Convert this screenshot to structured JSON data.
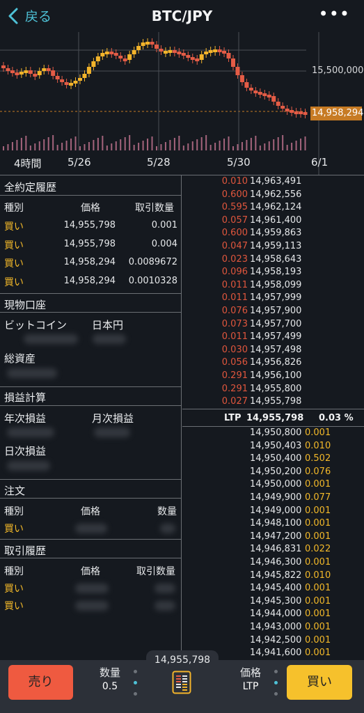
{
  "header": {
    "back_label": "戻る",
    "title": "BTC/JPY",
    "more": "•••"
  },
  "chart": {
    "price_label": "15,500,000",
    "last_price": "14,958,294",
    "x_labels": [
      "4時間",
      "5/26",
      "5/28",
      "5/30",
      "6/1"
    ],
    "colors": {
      "up": "#f3b42b",
      "down": "#e45c46",
      "volume": "#d47e9c",
      "grid": "#4a4e55",
      "last": "#c77b24"
    }
  },
  "executions": {
    "title": "全約定履歴",
    "headers": [
      "種別",
      "価格",
      "取引数量"
    ],
    "rows": [
      {
        "side": "買い",
        "price": "14,955,798",
        "qty": "0.001"
      },
      {
        "side": "買い",
        "price": "14,955,798",
        "qty": "0.004"
      },
      {
        "side": "買い",
        "price": "14,958,294",
        "qty": "0.0089672"
      },
      {
        "side": "買い",
        "price": "14,958,294",
        "qty": "0.0010328"
      }
    ]
  },
  "spot_account": {
    "title": "現物口座",
    "bitcoin": "ビットコイン",
    "jpy": "日本円",
    "total": "総資産"
  },
  "pnl": {
    "title": "損益計算",
    "yearly": "年次損益",
    "monthly": "月次損益",
    "daily": "日次損益"
  },
  "orders": {
    "title": "注文",
    "headers": [
      "種別",
      "価格",
      "数量"
    ],
    "rows": [
      {
        "side": "買い"
      }
    ]
  },
  "history": {
    "title": "取引履歴",
    "headers": [
      "種別",
      "価格",
      "取引数量"
    ],
    "rows": [
      {
        "side": "買い"
      },
      {
        "side": "買い"
      }
    ]
  },
  "orderbook": {
    "asks": [
      {
        "size": "0.010",
        "price": "14,963,491"
      },
      {
        "size": "0.600",
        "price": "14,962,556"
      },
      {
        "size": "0.595",
        "price": "14,962,124"
      },
      {
        "size": "0.057",
        "price": "14,961,400"
      },
      {
        "size": "0.600",
        "price": "14,959,863"
      },
      {
        "size": "0.047",
        "price": "14,959,113"
      },
      {
        "size": "0.023",
        "price": "14,958,643"
      },
      {
        "size": "0.096",
        "price": "14,958,193"
      },
      {
        "size": "0.011",
        "price": "14,958,099"
      },
      {
        "size": "0.011",
        "price": "14,957,999"
      },
      {
        "size": "0.076",
        "price": "14,957,900"
      },
      {
        "size": "0.073",
        "price": "14,957,700"
      },
      {
        "size": "0.011",
        "price": "14,957,499"
      },
      {
        "size": "0.030",
        "price": "14,957,498"
      },
      {
        "size": "0.056",
        "price": "14,956,826"
      },
      {
        "size": "0.291",
        "price": "14,956,100"
      },
      {
        "size": "0.291",
        "price": "14,955,800"
      },
      {
        "size": "0.027",
        "price": "14,955,798"
      }
    ],
    "ltp": {
      "label": "LTP",
      "price": "14,955,798",
      "change": "0.03 %"
    },
    "bids": [
      {
        "price": "14,950,800",
        "size": "0.001"
      },
      {
        "price": "14,950,403",
        "size": "0.010"
      },
      {
        "price": "14,950,400",
        "size": "0.502"
      },
      {
        "price": "14,950,200",
        "size": "0.076"
      },
      {
        "price": "14,950,000",
        "size": "0.001"
      },
      {
        "price": "14,949,900",
        "size": "0.077"
      },
      {
        "price": "14,949,000",
        "size": "0.001"
      },
      {
        "price": "14,948,100",
        "size": "0.001"
      },
      {
        "price": "14,947,200",
        "size": "0.001"
      },
      {
        "price": "14,946,831",
        "size": "0.022"
      },
      {
        "price": "14,946,300",
        "size": "0.001"
      },
      {
        "price": "14,945,822",
        "size": "0.010"
      },
      {
        "price": "14,945,400",
        "size": "0.001"
      },
      {
        "price": "14,945,300",
        "size": "0.001"
      },
      {
        "price": "14,944,000",
        "size": "0.001"
      },
      {
        "price": "14,943,000",
        "size": "0.001"
      },
      {
        "price": "14,942,500",
        "size": "0.001"
      },
      {
        "price": "14,941,600",
        "size": "0.001"
      }
    ]
  },
  "bottom": {
    "ticker": "14,955,798",
    "sell": "売り",
    "buy": "買い",
    "qty_label": "数量",
    "qty_value": "0.5",
    "price_label": "価格",
    "price_value": "LTP"
  }
}
